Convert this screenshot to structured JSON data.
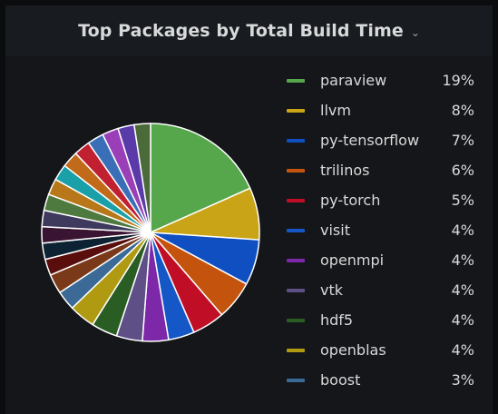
{
  "panel": {
    "title": "Top Packages by Total Build Time",
    "menu_icon": "chevron-down-icon"
  },
  "chart_data": {
    "type": "pie",
    "title": "Top Packages by Total Build Time",
    "legend_position": "right",
    "slices": [
      {
        "label": "paraview",
        "value": 19,
        "display": "19%",
        "color": "#56a64b"
      },
      {
        "label": "llvm",
        "value": 8,
        "display": "8%",
        "color": "#c9a416"
      },
      {
        "label": "py-tensorflow",
        "value": 7,
        "display": "7%",
        "color": "#0f4fc2"
      },
      {
        "label": "trilinos",
        "value": 6,
        "display": "6%",
        "color": "#c4540d"
      },
      {
        "label": "py-torch",
        "value": 5,
        "display": "5%",
        "color": "#c00e26"
      },
      {
        "label": "visit",
        "value": 4,
        "display": "4%",
        "color": "#1557c7"
      },
      {
        "label": "openmpi",
        "value": 4,
        "display": "4%",
        "color": "#7c28a8"
      },
      {
        "label": "vtk",
        "value": 4,
        "display": "4%",
        "color": "#5e4f87"
      },
      {
        "label": "hdf5",
        "value": 4,
        "display": "4%",
        "color": "#2a5d24"
      },
      {
        "label": "openblas",
        "value": 4,
        "display": "4%",
        "color": "#b09a12"
      },
      {
        "label": "boost",
        "value": 3,
        "display": "3%",
        "color": "#3b6a96"
      },
      {
        "value": 3,
        "color": "#7a3a1a"
      },
      {
        "value": 2.5,
        "color": "#5a0d0d"
      },
      {
        "value": 2.5,
        "color": "#0d2233"
      },
      {
        "value": 2.5,
        "color": "#3a1533"
      },
      {
        "value": 2.5,
        "color": "#3d3a5e"
      },
      {
        "value": 2.5,
        "color": "#4f7a3f"
      },
      {
        "value": 2.5,
        "color": "#b8781a"
      },
      {
        "value": 2.5,
        "color": "#1aa0a8"
      },
      {
        "value": 2.5,
        "color": "#c06a1a"
      },
      {
        "value": 2.5,
        "color": "#c02030"
      },
      {
        "value": 2.5,
        "color": "#3a6fb8"
      },
      {
        "value": 2.5,
        "color": "#9a3fb8"
      },
      {
        "value": 2.5,
        "color": "#5a3aa8"
      },
      {
        "value": 2.5,
        "color": "#4a6a3a"
      }
    ]
  }
}
